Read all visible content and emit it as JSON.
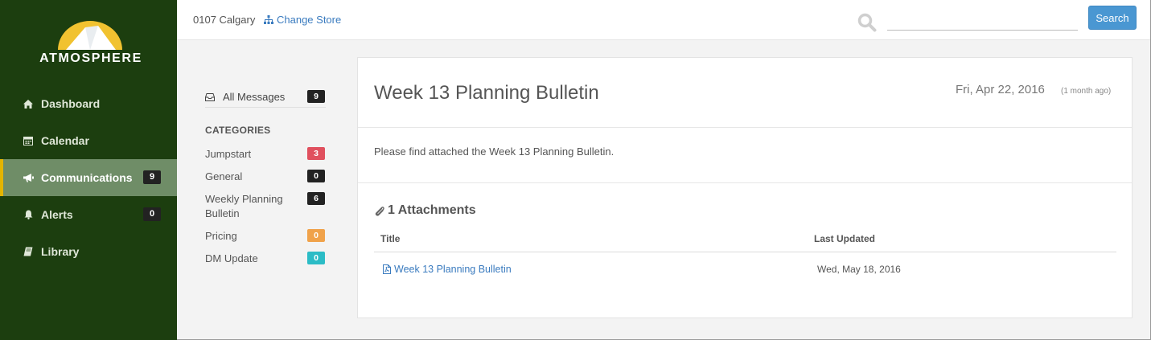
{
  "brand": {
    "name": "ATMOSPHERE"
  },
  "sidebar": {
    "items": [
      {
        "label": "Dashboard",
        "icon": "home-icon",
        "badge": null,
        "active": false
      },
      {
        "label": "Calendar",
        "icon": "calendar-icon",
        "badge": null,
        "active": false
      },
      {
        "label": "Communications",
        "icon": "megaphone-icon",
        "badge": "9",
        "active": true
      },
      {
        "label": "Alerts",
        "icon": "bell-icon",
        "badge": "0",
        "active": false
      },
      {
        "label": "Library",
        "icon": "book-icon",
        "badge": null,
        "active": false
      }
    ]
  },
  "header": {
    "store": "0107 Calgary",
    "change_store": "Change Store",
    "search_placeholder": "",
    "search_button": "Search"
  },
  "categories": {
    "all_messages": {
      "label": "All Messages",
      "count": "9"
    },
    "title": "CATEGORIES",
    "items": [
      {
        "label": "Jumpstart",
        "count": "3",
        "color": "#e0505e"
      },
      {
        "label": "General",
        "count": "0",
        "color": "#222222"
      },
      {
        "label": "Weekly Planning Bulletin",
        "count": "6",
        "color": "#222222"
      },
      {
        "label": "Pricing",
        "count": "0",
        "color": "#f0a24a"
      },
      {
        "label": "DM Update",
        "count": "0",
        "color": "#2bbcc6"
      }
    ]
  },
  "message": {
    "title": "Week 13 Planning Bulletin",
    "date": "Fri, Apr 22, 2016",
    "ago": "(1 month ago)",
    "body": "Please find attached the Week 13 Planning Bulletin.",
    "attachments_header": "1 Attachments",
    "columns": {
      "title": "Title",
      "updated": "Last Updated"
    },
    "attachments": [
      {
        "title": "Week 13 Planning Bulletin",
        "updated": "Wed, May 18, 2016"
      }
    ]
  },
  "colors": {
    "sidebar_bg": "#1c3e0f",
    "active_bg": "#6f8d67",
    "active_accent": "#e3b400",
    "link": "#3a7bbf",
    "search_button": "#4a97d2"
  }
}
